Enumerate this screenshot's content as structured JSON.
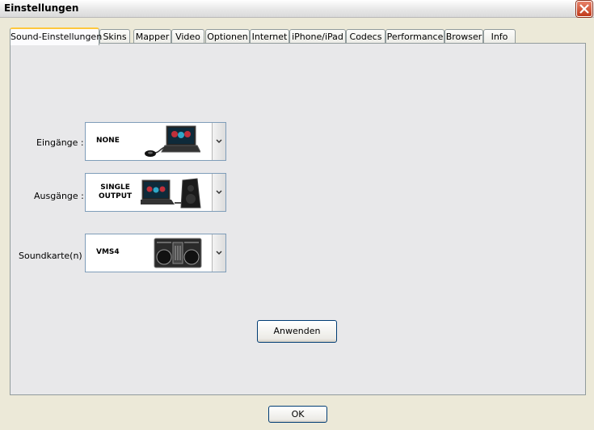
{
  "window": {
    "title": "Einstellungen"
  },
  "tabs": [
    {
      "label": "Sound-Einstellungen"
    },
    {
      "label": "Skins"
    },
    {
      "label": "Mapper"
    },
    {
      "label": "Video"
    },
    {
      "label": "Optionen"
    },
    {
      "label": "Internet"
    },
    {
      "label": "iPhone/iPad"
    },
    {
      "label": "Codecs"
    },
    {
      "label": "Performance"
    },
    {
      "label": "Browser"
    },
    {
      "label": "Info"
    }
  ],
  "settings": {
    "inputs": {
      "label": "Eingänge :",
      "value": "NONE",
      "icon": "laptop-mouse-icon"
    },
    "outputs": {
      "label": "Ausgänge :",
      "value_line1": "SINGLE",
      "value_line2": "OUTPUT",
      "icon": "laptop-speaker-icon"
    },
    "soundcard": {
      "label": "Soundkarte(n) :",
      "value": "VMS4",
      "icon": "dj-controller-icon"
    }
  },
  "buttons": {
    "apply": "Anwenden",
    "ok": "OK"
  },
  "colors": {
    "active_tab_accent": "#ffc83c",
    "close_button": "#c0391a",
    "panel_bg": "#e8e8ea"
  }
}
